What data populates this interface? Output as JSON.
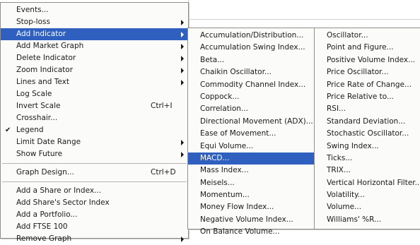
{
  "main_menu": [
    {
      "label": "Events...",
      "submenu": false
    },
    {
      "label": "Stop-loss",
      "submenu": true
    },
    {
      "label": "Add Indicator",
      "submenu": true,
      "highlighted": true
    },
    {
      "label": "Add Market Graph",
      "submenu": true
    },
    {
      "label": "Delete Indicator",
      "submenu": true
    },
    {
      "label": "Zoom Indicator",
      "submenu": true
    },
    {
      "label": "Lines and Text",
      "submenu": true
    },
    {
      "label": "Log Scale",
      "submenu": false
    },
    {
      "label": "Invert Scale",
      "shortcut": "Ctrl+I"
    },
    {
      "label": "Crosshair...",
      "submenu": false
    },
    {
      "label": "Legend",
      "checked": true
    },
    {
      "label": "Limit Date Range",
      "submenu": true
    },
    {
      "label": "Show Future",
      "submenu": true
    },
    {
      "separator": true
    },
    {
      "label": "Graph Design...",
      "shortcut": "Ctrl+D"
    },
    {
      "separator": true
    },
    {
      "label": "Add a Share or Index...",
      "submenu": false
    },
    {
      "label": "Add Share's Sector Index",
      "submenu": false
    },
    {
      "label": "Add a Portfolio...",
      "submenu": false
    },
    {
      "label": "Add FTSE 100",
      "submenu": false
    },
    {
      "label": "Remove Graph",
      "submenu": true
    }
  ],
  "indicators_col1": [
    "Accumulation/Distribution...",
    "Accumulation Swing Index...",
    "Beta...",
    "Chaikin Oscillator...",
    "Commodity Channel Index...",
    "Coppock...",
    "Correlation...",
    "Directional Movement (ADX)...",
    "Ease of Movement...",
    "Equi Volume...",
    "MACD...",
    "Mass Index...",
    "Meisels...",
    "Momentum...",
    "Money Flow Index...",
    "Negative Volume Index...",
    "On Balance Volume..."
  ],
  "indicators_col1_highlighted_index": 10,
  "indicators_col2": [
    "Oscillator...",
    "Point and Figure...",
    "Positive Volume Index...",
    "Price Oscillator...",
    "Price Rate of Change...",
    "Price Relative to...",
    "RSI...",
    "Standard Deviation...",
    "Stochastic Oscillator...",
    "Swing Index...",
    "Ticks...",
    "TRIX...",
    "Vertical Horizontal Filter...",
    "Volatility...",
    "Volume...",
    "Williams' %R..."
  ],
  "colors": {
    "highlight": "#2f5fbf",
    "menu_bg": "#fbfbf9"
  }
}
